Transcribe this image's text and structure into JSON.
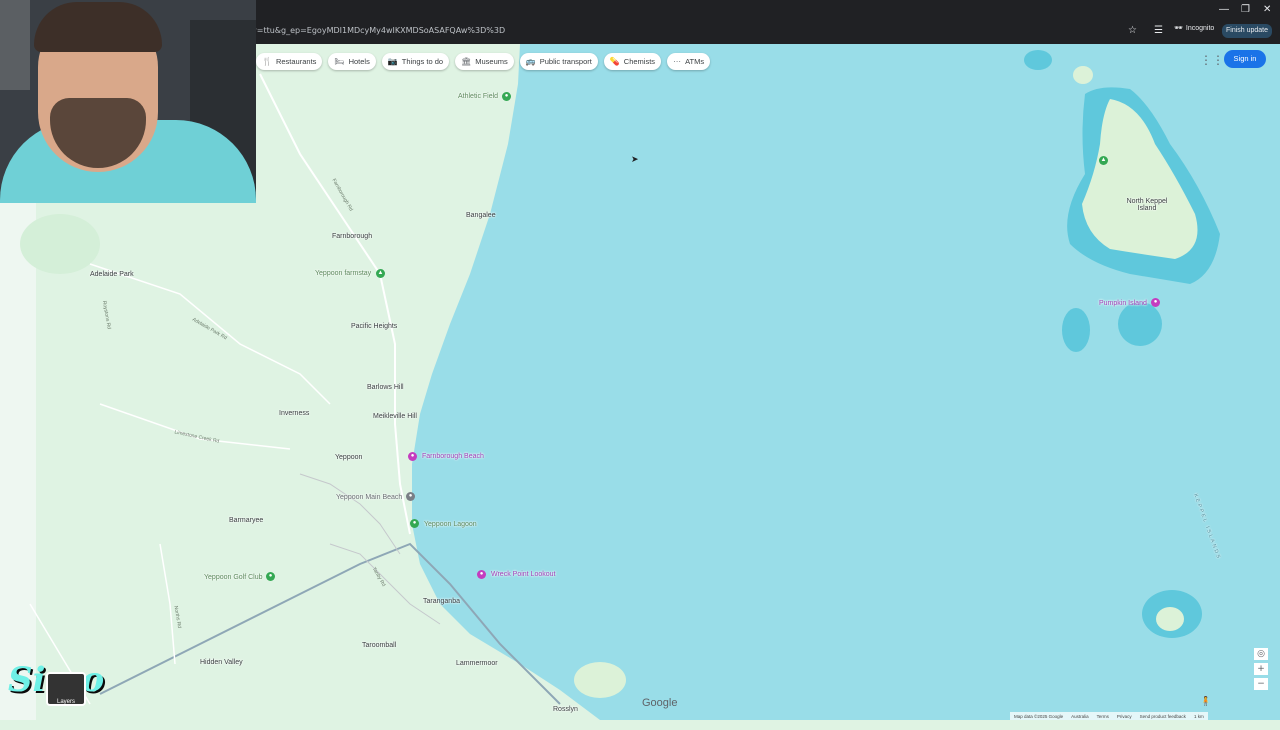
{
  "browser": {
    "url": "y=ttu&g_ep=EgoyMDI1MDcyMy4wIKXMDSoASAFQAw%3D%3D",
    "incognito_label": "Incognito",
    "finish_update_label": "Finish update",
    "minimize_icon": "minimize-icon",
    "maximize_icon": "maximize-icon",
    "close_icon": "close-icon"
  },
  "map": {
    "chips": [
      {
        "label": "Restaurants",
        "icon": "fork-knife-icon",
        "glyph": "🍴"
      },
      {
        "label": "Hotels",
        "icon": "bed-icon",
        "glyph": "🛏"
      },
      {
        "label": "Things to do",
        "icon": "camera-icon",
        "glyph": "📷"
      },
      {
        "label": "Museums",
        "icon": "museum-icon",
        "glyph": "🏛"
      },
      {
        "label": "Public transport",
        "icon": "bus-icon",
        "glyph": "🚌"
      },
      {
        "label": "Chemists",
        "icon": "pharmacy-icon",
        "glyph": "💊"
      },
      {
        "label": "ATMs",
        "icon": "more-icon",
        "glyph": "···"
      }
    ],
    "sign_in_label": "Sign in",
    "google_logo": "Google",
    "layers_label": "Layers",
    "places": {
      "athletic_field": "Athletic Field",
      "bangalee": "Bangalee",
      "farnborough": "Farnborough",
      "adelaide_park": "Adelaide Park",
      "yeppoon_farmstay": "Yeppoon farmstay",
      "pacific_heights": "Pacific Heights",
      "barlows_hill": "Barlows Hill",
      "inverness": "Inverness",
      "meikleville_hill": "Meikleville Hill",
      "yeppoon": "Yeppoon",
      "farnborough_beach": "Farnborough Beach",
      "yeppoon_main_beach": "Yeppoon Main Beach",
      "yeppoon_lagoon": "Yeppoon Lagoon",
      "barmaryee": "Barmaryee",
      "yeppoon_golf_club": "Yeppoon Golf Club",
      "wreck_point_lookout": "Wreck Point Lookout",
      "taranganba": "Taranganba",
      "hidden_valley": "Hidden Valley",
      "taroomball": "Taroomball",
      "lammermoor": "Lammermoor",
      "rosslyn": "Rosslyn",
      "north_keppel_island": "North Keppel Island",
      "pumpkin_island": "Pumpkin Island",
      "keppel_islands": "KEPPEL ISLANDS"
    },
    "roads": {
      "farnborough_rd": "Farnborough Rd",
      "adelaide_park_rd": "Adelaide Park Rd",
      "limestone_creek_rd": "Limestone Creek Rd",
      "roystons_rd": "Roystons Rd",
      "tanby_rd": "Tanby Rd",
      "norths_rd": "Norths Rd"
    },
    "footer": [
      "Map data ©2025 Google",
      "Australia",
      "Terms",
      "Privacy",
      "Send product feedback",
      "1 km"
    ]
  },
  "overlay": {
    "channel_logo": "Simo"
  },
  "colors": {
    "water": "#99dde8",
    "land": "#dff3e3",
    "sign_in": "#1a73e8",
    "poi_green": "#34a853",
    "poi_pink": "#c43cbf"
  }
}
